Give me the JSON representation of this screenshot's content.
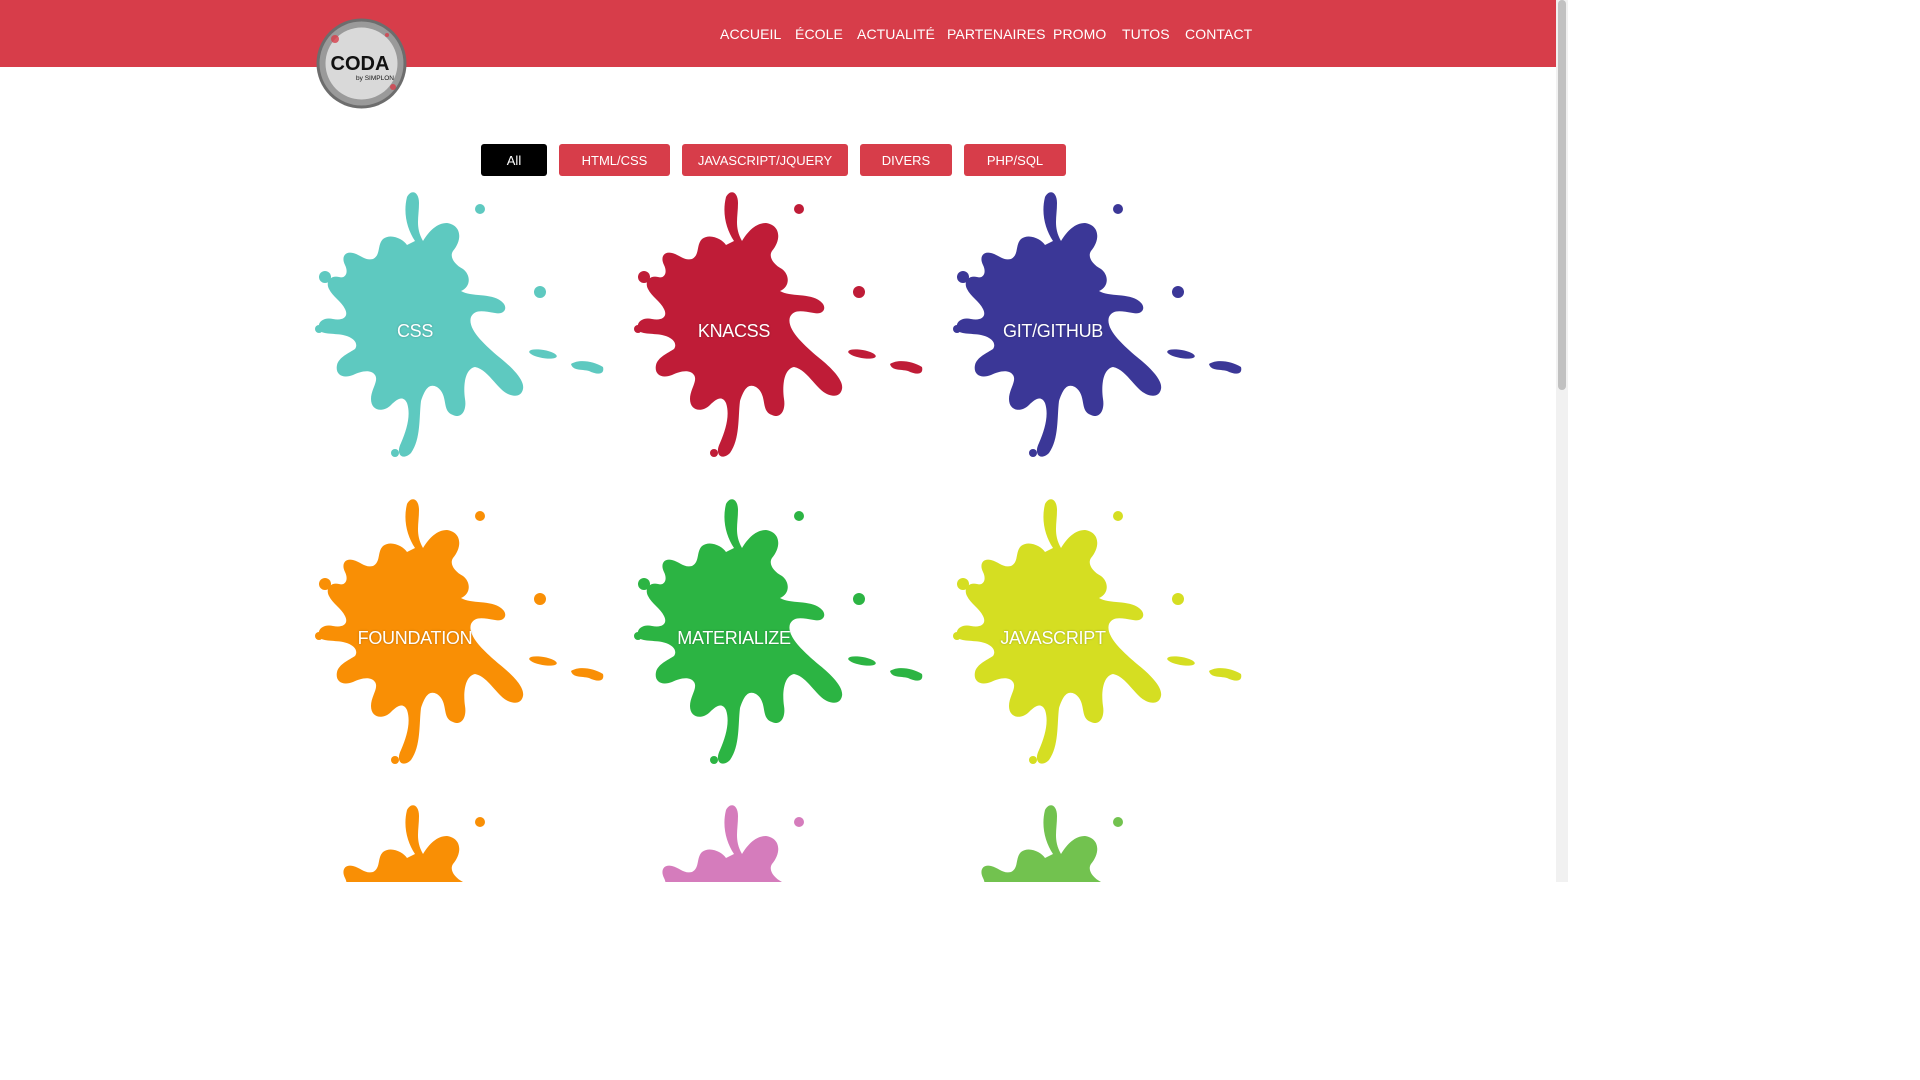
{
  "header": {
    "logo_text": "CODA",
    "logo_sub": "by SIMPLON",
    "nav": [
      "ACCUEIL",
      "ÉCOLE",
      "ACTUALITÉ",
      "PARTENAIRES",
      "PROMO",
      "TUTOS",
      "CONTACT"
    ]
  },
  "filters": {
    "active": "All",
    "buttons": [
      "All",
      "HTML/CSS",
      "JAVASCRIPT/JQUERY",
      "DIVERS",
      "PHP/SQL"
    ]
  },
  "tiles": [
    {
      "label": "CSS",
      "color": "#5ec9c0"
    },
    {
      "label": "KNACSS",
      "color": "#bf1c37"
    },
    {
      "label": "GIT/GITHUB",
      "color": "#3b3797"
    },
    {
      "label": "FOUNDATION",
      "color": "#f98f05"
    },
    {
      "label": "MATERIALIZE",
      "color": "#2cb443"
    },
    {
      "label": "JAVASCRIPT",
      "color": "#d5de22"
    },
    {
      "label": "",
      "color": "#f98f05"
    },
    {
      "label": "",
      "color": "#d57cbc"
    },
    {
      "label": "",
      "color": "#72c24f"
    }
  ],
  "colors": {
    "brand": "#d73d4a",
    "active_filter": "#000000"
  }
}
